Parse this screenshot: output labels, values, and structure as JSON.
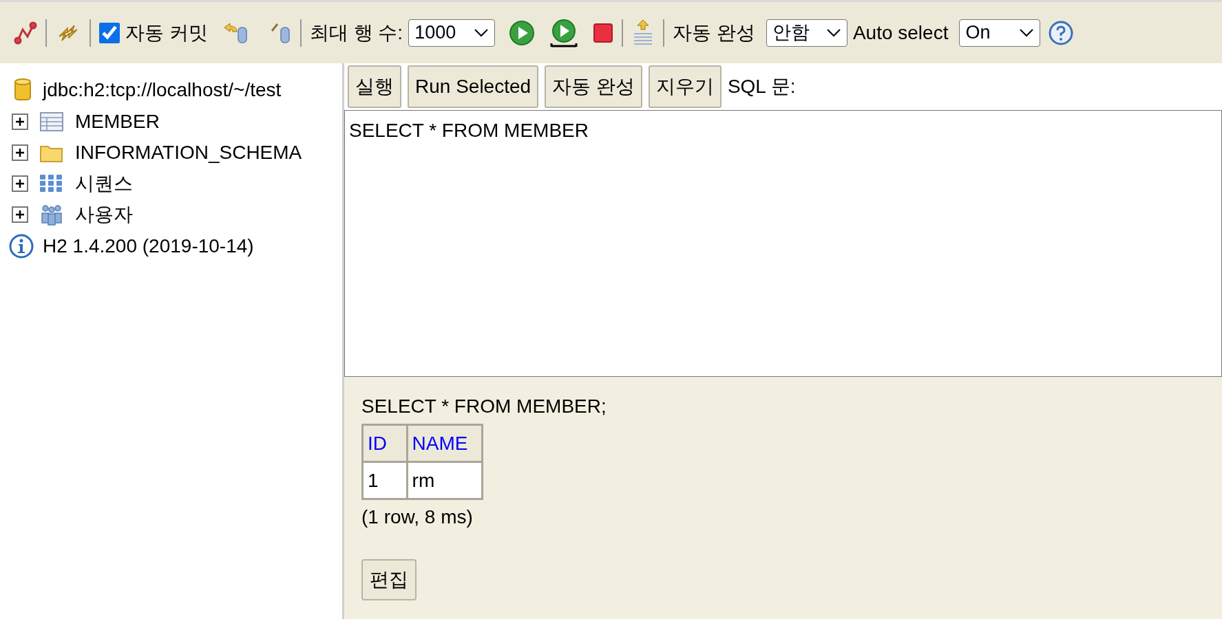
{
  "toolbar": {
    "autocommit": {
      "label": "자동 커밋",
      "checked": true
    },
    "max_rows": {
      "label": "최대 행 수:",
      "value": "1000"
    },
    "autocomplete": {
      "label": "자동 완성",
      "value": "안함"
    },
    "auto_select": {
      "label": "Auto select",
      "value": "On"
    }
  },
  "tree": {
    "connection": "jdbc:h2:tcp://localhost/~/test",
    "items": [
      {
        "kind": "table",
        "label": "MEMBER",
        "expanded": false
      },
      {
        "kind": "schema",
        "label": "INFORMATION_SCHEMA",
        "expanded": false
      },
      {
        "kind": "sequences",
        "label": "시퀀스",
        "expanded": false
      },
      {
        "kind": "users",
        "label": "사용자",
        "expanded": false
      }
    ],
    "version": "H2 1.4.200 (2019-10-14)"
  },
  "buttons": [
    "실행",
    "Run Selected",
    "자동 완성",
    "지우기"
  ],
  "sql_label": "SQL 문:",
  "editor": {
    "value": "SELECT * FROM MEMBER"
  },
  "result": {
    "statement": "SELECT * FROM MEMBER;",
    "columns": [
      "ID",
      "NAME"
    ],
    "rows": [
      [
        "1",
        "rm"
      ]
    ],
    "summary": "(1 row, 8 ms)",
    "edit_button": "편집"
  }
}
